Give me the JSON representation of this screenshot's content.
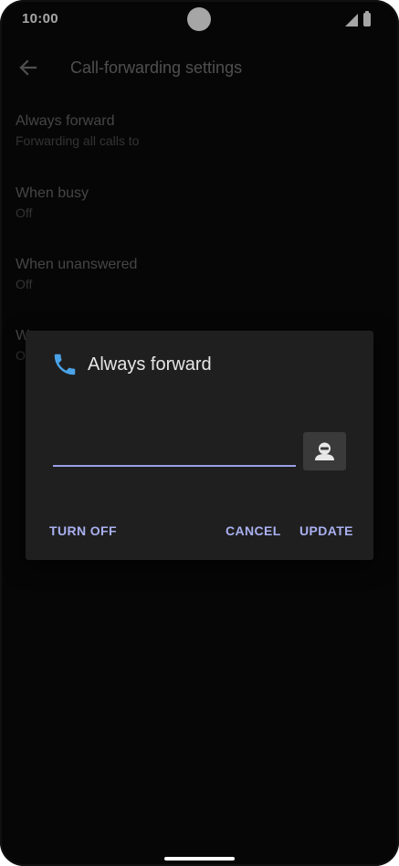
{
  "status_bar": {
    "time": "10:00"
  },
  "app_bar": {
    "title": "Call-forwarding settings",
    "back_icon": "arrow-left-icon"
  },
  "settings": [
    {
      "title": "Always forward",
      "summary": "Forwarding all calls to"
    },
    {
      "title": "When busy",
      "summary": "Off"
    },
    {
      "title": "When unanswered",
      "summary": "Off"
    },
    {
      "title": "W",
      "summary": "O"
    }
  ],
  "dialog": {
    "icon": "phone-icon",
    "title": "Always forward",
    "input_value": "",
    "contact_icon": "contact-icon",
    "buttons": {
      "turn_off": "TURN OFF",
      "cancel": "CANCEL",
      "update": "UPDATE"
    }
  },
  "colors": {
    "accent": "#a9b0f0",
    "phone_icon": "#4aa3e8",
    "dialog_bg": "#1f1f1f",
    "background": "#0a0a0a"
  }
}
